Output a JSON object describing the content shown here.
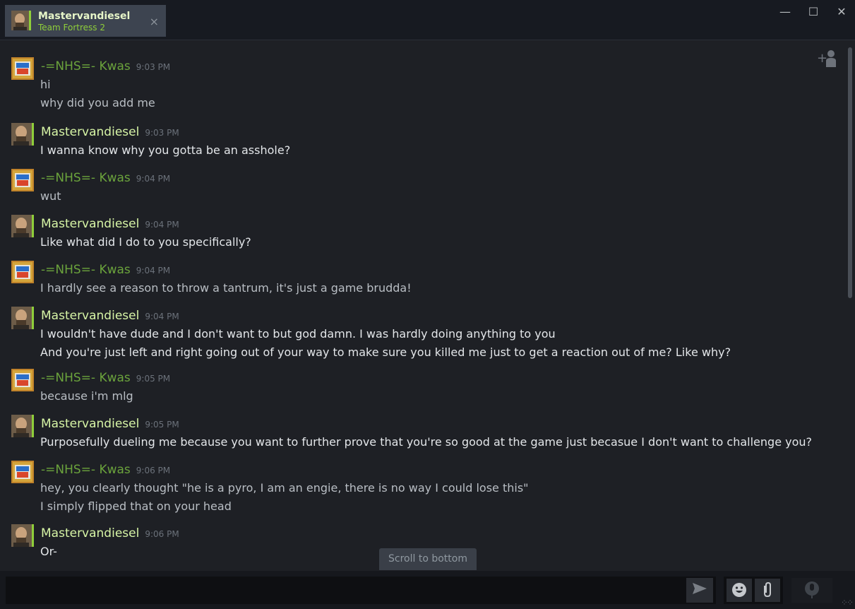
{
  "tab": {
    "name": "Mastervandiesel",
    "game": "Team Fortress 2",
    "close_icon": "×"
  },
  "window": {
    "minimize": "—",
    "maximize": "☐",
    "close": "✕"
  },
  "messages": [
    {
      "sender": "-=NHS=- Kwas",
      "time": "9:03 PM",
      "lines": [
        "hi",
        "why did you add me"
      ]
    },
    {
      "sender": "Mastervandiesel",
      "time": "9:03 PM",
      "lines": [
        "I wanna know why you gotta be an asshole?"
      ]
    },
    {
      "sender": "-=NHS=- Kwas",
      "time": "9:04 PM",
      "lines": [
        "wut"
      ]
    },
    {
      "sender": "Mastervandiesel",
      "time": "9:04 PM",
      "lines": [
        "Like what did I do to you specifically?"
      ]
    },
    {
      "sender": "-=NHS=- Kwas",
      "time": "9:04 PM",
      "lines": [
        "I hardly see a reason to throw a tantrum, it's just a game brudda!"
      ]
    },
    {
      "sender": "Mastervandiesel",
      "time": "9:04 PM",
      "lines": [
        "I wouldn't have dude and I don't want to but god damn. I was hardly doing anything to you",
        "And you're just left and right going out of your way to make sure you killed me just to get a reaction out of me? Like why?"
      ]
    },
    {
      "sender": "-=NHS=- Kwas",
      "time": "9:05 PM",
      "lines": [
        "because i'm mlg"
      ]
    },
    {
      "sender": "Mastervandiesel",
      "time": "9:05 PM",
      "lines": [
        "Purposefully dueling me because you want to further prove that you're so good at the game just becasue I don't want to challenge you?"
      ]
    },
    {
      "sender": "-=NHS=- Kwas",
      "time": "9:06 PM",
      "lines": [
        "hey, you clearly thought \"he is a pyro, I am an engie, there is no way I could lose this\"",
        "I simply flipped that on your head"
      ]
    },
    {
      "sender": "Mastervandiesel",
      "time": "9:06 PM",
      "lines": [
        "Or-"
      ]
    }
  ],
  "scroll_to_bottom": "Scroll to bottom",
  "input": {
    "value": "",
    "placeholder": ""
  },
  "icons": {
    "add_friend": "add-friend-icon",
    "send": "send-icon",
    "emoticon": "emoticon-icon",
    "attach": "paperclip-icon",
    "voice": "microphone-icon"
  },
  "colors": {
    "accent_green": "#8fcf3a",
    "kwas_name": "#6ba33c",
    "self_name": "#d7f5a6"
  }
}
